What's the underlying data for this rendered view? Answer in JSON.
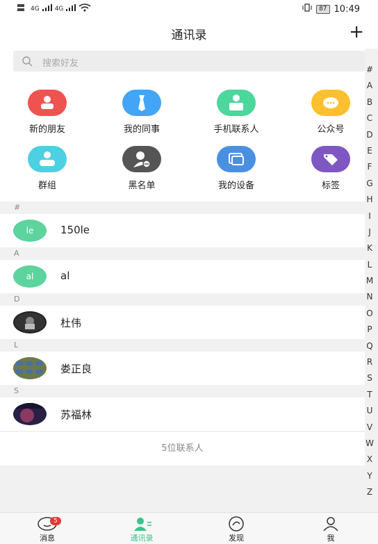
{
  "status": {
    "sim": "4G",
    "sim2": "4G",
    "battery": "87",
    "time": "10:49"
  },
  "header": {
    "title": "通讯录",
    "plus": "+"
  },
  "search": {
    "placeholder": "搜索好友"
  },
  "functions": [
    {
      "label": "新的朋友",
      "color": "#ef5350",
      "icon": "new-friends-icon"
    },
    {
      "label": "我的同事",
      "color": "#42a5f5",
      "icon": "colleagues-icon"
    },
    {
      "label": "手机联系人",
      "color": "#4cd79c",
      "icon": "phone-contacts-icon"
    },
    {
      "label": "公众号",
      "color": "#fbc02d",
      "icon": "official-account-icon"
    },
    {
      "label": "群组",
      "color": "#4dd0e1",
      "icon": "group-icon"
    },
    {
      "label": "黑名单",
      "color": "#555555",
      "icon": "blacklist-icon"
    },
    {
      "label": "我的设备",
      "color": "#4a90e2",
      "icon": "devices-icon"
    },
    {
      "label": "标签",
      "color": "#7e57c2",
      "icon": "tag-icon"
    }
  ],
  "index_letters": [
    "#",
    "A",
    "B",
    "C",
    "D",
    "E",
    "F",
    "G",
    "H",
    "I",
    "J",
    "K",
    "L",
    "M",
    "N",
    "O",
    "P",
    "Q",
    "R",
    "S",
    "T",
    "U",
    "V",
    "W",
    "X",
    "Y",
    "Z"
  ],
  "sections": [
    {
      "letter": "#",
      "contact": {
        "avatar_text": "le",
        "name": "150le",
        "avatar_color": "#5dd39e"
      }
    },
    {
      "letter": "A",
      "contact": {
        "avatar_text": "al",
        "name": "al",
        "avatar_color": "#5dd39e"
      }
    },
    {
      "letter": "D",
      "contact": {
        "avatar_text": "",
        "name": "杜伟",
        "avatar_color": "#222222"
      }
    },
    {
      "letter": "L",
      "contact": {
        "avatar_text": "",
        "name": "娄正良",
        "avatar_color": "#6b7a4e"
      }
    },
    {
      "letter": "S",
      "contact": {
        "avatar_text": "",
        "name": "苏福林",
        "avatar_color": "#3a2a5a"
      }
    }
  ],
  "contact_count": "5位联系人",
  "tabs": [
    {
      "label": "消息",
      "active": false,
      "badge": "5"
    },
    {
      "label": "通讯录",
      "active": true
    },
    {
      "label": "发现",
      "active": false
    },
    {
      "label": "我",
      "active": false
    }
  ],
  "colors": {
    "accent": "#3bc389",
    "badge": "#e53935"
  }
}
